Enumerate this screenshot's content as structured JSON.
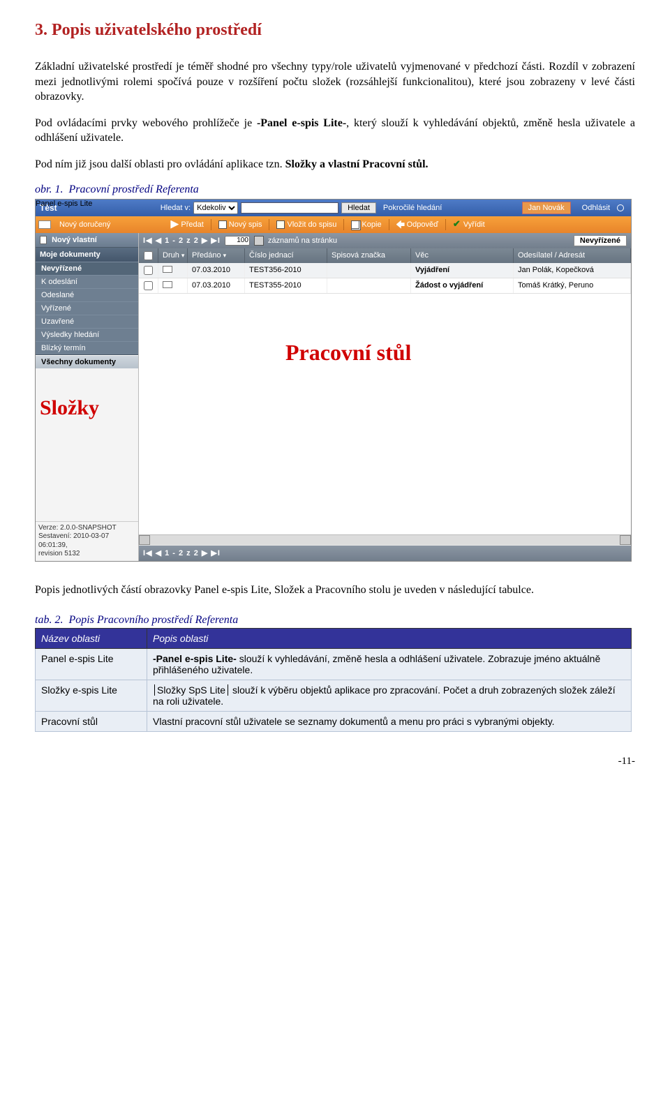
{
  "section": {
    "number": "3.",
    "title": "Popis uživatelského prostředí"
  },
  "paragraphs": {
    "p1": "Základní uživatelské prostředí je téměř shodné pro všechny typy/role uživatelů vyjmenované v předchozí části. Rozdíl v zobrazení mezi jednotlivými rolemi spočívá pouze v rozšíření počtu složek (rozsáhlejší funkcionalitou), které jsou zobrazeny v levé části obrazovky.",
    "p2a": "Pod ovládacími prvky webového prohlížeče je ",
    "p2b": "-Panel e-spis Lite-",
    "p2c": ", který slouží k vyhledávání objektů, změně hesla uživatele a odhlášení uživatele.",
    "p3a": "Pod ním již jsou další oblasti pro ovládání aplikace tzn. ",
    "p3b": "Složky a vlastní Pracovní stůl.",
    "fig_label": "obr. 1.",
    "fig_title": "Pracovní prostředí Referenta"
  },
  "app": {
    "overlay_panel": "Panel e-spis Lite",
    "overlay_slozky": "Složky",
    "overlay_pracovni": "Pracovní stůl",
    "top": {
      "hledat_v_label": "Hledat v:",
      "hledat_v_value": "Kdekoliv",
      "search_value": "",
      "btn_hledat": "Hledat",
      "link_pokrocile": "Pokročilé hledání",
      "user": "Jan Novák",
      "logout": "Odhlásit"
    },
    "toolbar": {
      "novy_doruceny": "Nový doručený",
      "predat": "Předat",
      "novy_spis": "Nový spis",
      "vlozit": "Vložit do spisu",
      "kopie": "Kopie",
      "odpoved": "Odpověď",
      "vyridit": "Vyřídit"
    },
    "sidebar": {
      "tab_novy_vlastni": "Nový vlastní",
      "group": "Moje dokumenty",
      "items": [
        "Nevyřízené",
        "K odeslání",
        "Odeslané",
        "Vyřízené",
        "Uzavřené",
        "Výsledky hledání",
        "Blízký termín"
      ],
      "vsechny": "Všechny dokumenty"
    },
    "pager": {
      "nav": "I◀ ◀  1 - 2 z 2  ▶ ▶I",
      "per_page": "100",
      "per_page_label": "záznamů na stránku",
      "right_label": "Nevyřízené"
    },
    "grid": {
      "headers": {
        "chk": "",
        "druh": "Druh",
        "predano": "Předáno",
        "cj": "Číslo jednací",
        "sz": "Spisová značka",
        "vec": "Věc",
        "odes": "Odesílatel / Adresát"
      },
      "rows": [
        {
          "predano": "07.03.2010",
          "cj": "TEST356-2010",
          "sz": "",
          "vec": "Vyjádření",
          "odes": "Jan Polák, Kopečková"
        },
        {
          "predano": "07.03.2010",
          "cj": "TEST355-2010",
          "sz": "",
          "vec": "Žádost o vyjádření",
          "odes": "Tomáš Krátký, Peruno"
        }
      ]
    },
    "version": {
      "l1": "Verze: 2.0.0-SNAPSHOT",
      "l2": "Sestavení: 2010-03-07 06:01:39,",
      "l3": "revision 5132"
    },
    "pager_bottom_nav": "I◀ ◀  1 - 2 z 2  ▶ ▶I"
  },
  "desc_intro": "Popis jednotlivých částí obrazovky Panel e-spis Lite, Složek a Pracovního stolu je uveden v následující tabulce.",
  "desc_table": {
    "caption_label": "tab. 2.",
    "caption_title": "Popis Pracovního prostředí Referenta",
    "head_name": "Název oblasti",
    "head_desc": "Popis oblasti",
    "rows": [
      {
        "name": "Panel e-spis Lite",
        "desc_pre": "",
        "bold": "-Panel e-spis Lite-",
        "desc_post": " slouží k vyhledávání, změně hesla a odhlášení uživatele. Zobrazuje jméno aktuálně přihlášeného uživatele."
      },
      {
        "name": "Složky e-spis Lite",
        "desc_pre": "",
        "frame": "Složky SpS Lite",
        "desc_post": " slouží k výběru objektů aplikace pro zpracování. Počet a druh zobrazených složek záleží na roli uživatele."
      },
      {
        "name": "Pracovní stůl",
        "desc_pre": "Vlastní pracovní stůl uživatele se seznamy dokumentů a menu pro práci s vybranými objekty.",
        "bold": "",
        "desc_post": ""
      }
    ]
  },
  "page_number": "-11-"
}
